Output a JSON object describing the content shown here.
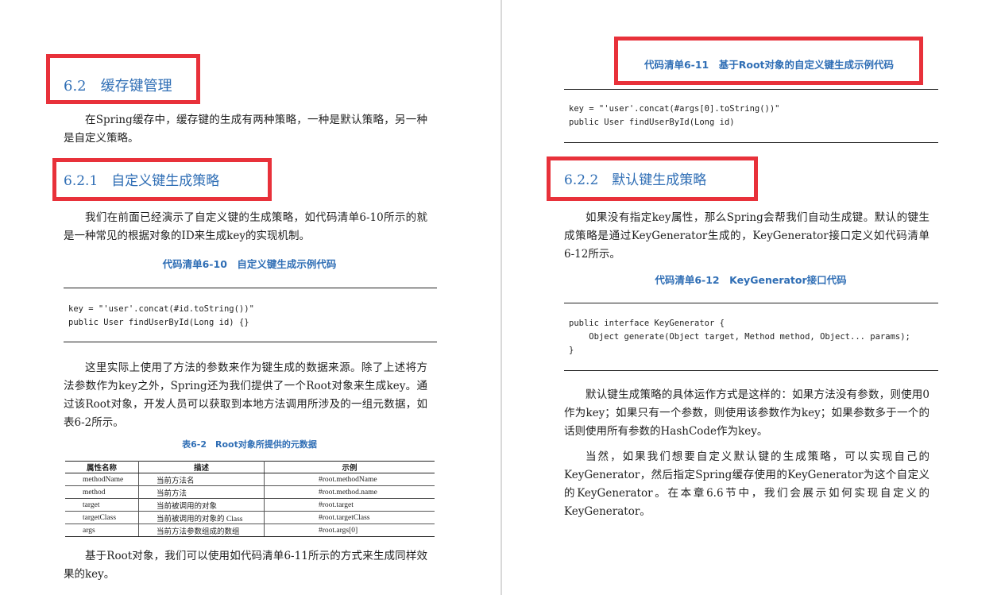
{
  "left": {
    "h_6_2": "6.2　缓存键管理",
    "p1": "在Spring缓存中，缓存键的生成有两种策略，一种是默认策略，另一种是自定义策略。",
    "h_6_2_1": "6.2.1　自定义键生成策略",
    "p2": "我们在前面已经演示了自定义键的生成策略，如代码清单6-10所示的就是一种常见的根据对象的ID来生成key的实现机制。",
    "cap_6_10": "代码清单6-10　自定义键生成示例代码",
    "code_6_10": "key = \"'user'.concat(#id.toString())\"\npublic User findUserById(Long id) {}",
    "p3": "这里实际上使用了方法的参数来作为键生成的数据来源。除了上述将方法参数作为key之外，Spring还为我们提供了一个Root对象来生成key。通过该Root对象，开发人员可以获取到本地方法调用所涉及的一组元数据，如表6-2所示。",
    "cap_table": "表6-2　Root对象所提供的元数据",
    "table": {
      "headers": [
        "属性名称",
        "描述",
        "示例"
      ],
      "rows": [
        [
          "methodName",
          "当前方法名",
          "#root.methodName"
        ],
        [
          "method",
          "当前方法",
          "#root.method.name"
        ],
        [
          "target",
          "当前被调用的对象",
          "#root.target"
        ],
        [
          "targetClass",
          "当前被调用的对象的 Class",
          "#root.targetClass"
        ],
        [
          "args",
          "当前方法参数组成的数组",
          "#root.args[0]"
        ]
      ]
    },
    "p4": "基于Root对象，我们可以使用如代码清单6-11所示的方式来生成同样效果的key。"
  },
  "right": {
    "cap_6_11": "代码清单6-11　基于Root对象的自定义键生成示例代码",
    "code_6_11": "key = \"'user'.concat(#args[0].toString())\"\npublic User findUserById(Long id)",
    "h_6_2_2": "6.2.2　默认键生成策略",
    "p5": "如果没有指定key属性，那么Spring会帮我们自动生成键。默认的键生成策略是通过KeyGenerator生成的，KeyGenerator接口定义如代码清单6-12所示。",
    "cap_6_12": "代码清单6-12　KeyGenerator接口代码",
    "code_6_12": "public interface KeyGenerator {\n    Object generate(Object target, Method method, Object... params);\n}",
    "p6": "默认键生成策略的具体运作方式是这样的：如果方法没有参数，则使用0作为key；如果只有一个参数，则使用该参数作为key；如果参数多于一个的话则使用所有参数的HashCode作为key。",
    "p7": "当然，如果我们想要自定义默认键的生成策略，可以实现自己的KeyGenerator，然后指定Spring缓存使用的KeyGenerator为这个自定义的KeyGenerator。在本章6.6节中，我们会展示如何实现自定义的KeyGenerator。"
  },
  "colors": {
    "heading": "#2f6eb5",
    "highlight_box": "#e8313a"
  }
}
